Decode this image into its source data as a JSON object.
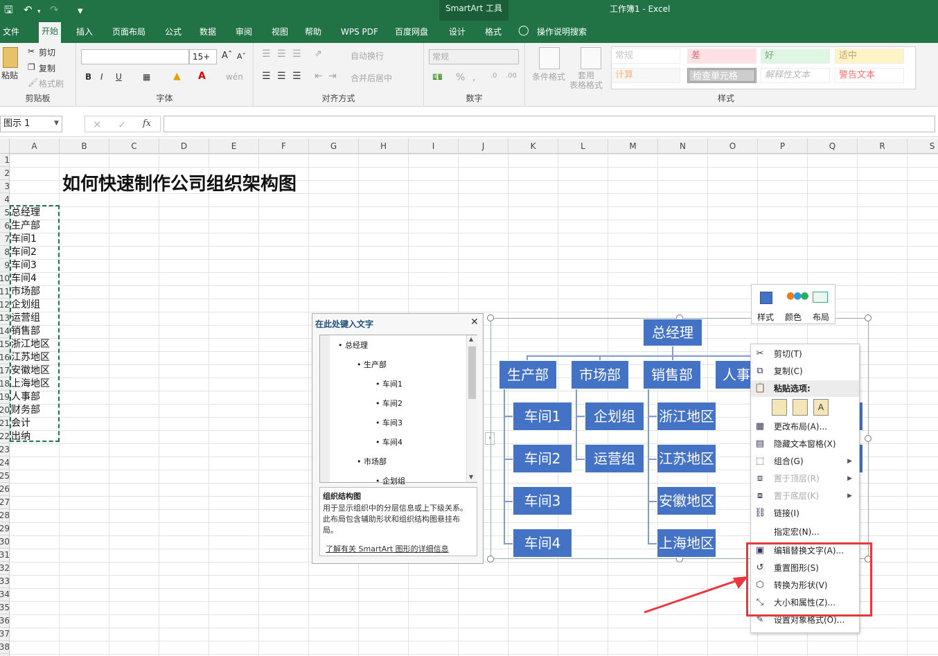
{
  "titlebar": {
    "context_label": "SmartArt 工具",
    "window_title": "工作簿1  -  Excel"
  },
  "tabs": [
    {
      "label": "文件"
    },
    {
      "label": "开始"
    },
    {
      "label": "插入"
    },
    {
      "label": "页面布局"
    },
    {
      "label": "公式"
    },
    {
      "label": "数据"
    },
    {
      "label": "审阅"
    },
    {
      "label": "视图"
    },
    {
      "label": "帮助"
    },
    {
      "label": "WPS PDF"
    },
    {
      "label": "百度网盘"
    },
    {
      "label": "设计"
    },
    {
      "label": "格式"
    }
  ],
  "tellme": "操作说明搜索",
  "ribbon": {
    "clipboard": {
      "paste": "粘贴",
      "cut": "剪切",
      "copy": "复制",
      "format_painter": "格式刷",
      "label": "剪贴板"
    },
    "font": {
      "size": "15+",
      "label": "字体",
      "bold": "B",
      "italic": "I",
      "underline": "U"
    },
    "align": {
      "wrap": "自动换行",
      "merge": "合并后居中",
      "label": "对齐方式"
    },
    "number": {
      "format": "常规",
      "percent": "%",
      "comma": ",",
      "label": "数字"
    },
    "styles": {
      "cond": "条件格式",
      "table": "套用\n表格格式",
      "label": "样式",
      "cells": [
        "常规",
        "差",
        "好",
        "适中",
        "计算",
        "检查单元格",
        "解释性文本",
        "警告文本"
      ]
    }
  },
  "formula_bar": {
    "name_box": "图示 1",
    "fx": "fx"
  },
  "columns": [
    "A",
    "B",
    "C",
    "D",
    "E",
    "F",
    "G",
    "H",
    "I",
    "J",
    "K",
    "L",
    "M",
    "N",
    "O",
    "P",
    "Q",
    "R",
    "S"
  ],
  "rows": [
    "1",
    "2",
    "3",
    "4",
    "5",
    "6",
    "7",
    "8",
    "9",
    "10",
    "11",
    "12",
    "13",
    "14",
    "15",
    "16",
    "17",
    "18",
    "19",
    "20",
    "21",
    "22",
    "23",
    "24",
    "25",
    "26",
    "27",
    "28",
    "29",
    "30",
    "31",
    "32",
    "33",
    "34",
    "35",
    "36",
    "37",
    "38"
  ],
  "sheet": {
    "title": "如何快速制作公司组织架构图",
    "list": [
      "总经理",
      "生产部",
      "车间1",
      "车间2",
      "车间3",
      "车间4",
      "市场部",
      "企划组",
      "运营组",
      "销售部",
      "浙江地区",
      "江苏地区",
      "安徽地区",
      "上海地区",
      "人事部",
      "财务部",
      "会计",
      "出纳"
    ]
  },
  "text_pane": {
    "header": "在此处键入文字",
    "bullets": [
      "总经理",
      "生产部",
      "车间1",
      "车间2",
      "车间3",
      "车间4",
      "市场部",
      "企划组"
    ],
    "desc_title": "组织结构图",
    "desc": "用于显示组织中的分层信息或上下级关系。此布局包含辅助形状和组织结构图悬挂布局。",
    "link": "了解有关 SmartArt 图形的详细信息"
  },
  "smartart": {
    "top": "总经理",
    "level2": [
      "生产部",
      "市场部",
      "销售部",
      "人事"
    ],
    "col1": [
      "车间1",
      "车间2",
      "车间3",
      "车间4"
    ],
    "col2": [
      "企划组",
      "运营组"
    ],
    "col3": [
      "浙江地区",
      "江苏地区",
      "安徽地区",
      "上海地区"
    ]
  },
  "minibar": {
    "style": "样式",
    "color": "颜色",
    "layout": "布局"
  },
  "context_menu": [
    {
      "label": "剪切(T)",
      "icon": "scissors-icon",
      "dim": false
    },
    {
      "label": "复制(C)",
      "icon": "copy-icon",
      "dim": false
    },
    {
      "label": "粘贴选项:",
      "icon": "paste-icon",
      "dim": false,
      "header": true
    },
    {
      "label": "更改布局(A)...",
      "icon": "layout-icon",
      "dim": false
    },
    {
      "label": "隐藏文本窗格(X)",
      "icon": "textpane-icon",
      "dim": false
    },
    {
      "label": "组合(G)",
      "icon": "group-icon",
      "dim": false,
      "sub": true
    },
    {
      "label": "置于顶层(R)",
      "icon": "bring-front-icon",
      "dim": true,
      "sub": true
    },
    {
      "label": "置于底层(K)",
      "icon": "send-back-icon",
      "dim": true,
      "sub": true
    },
    {
      "label": "链接(I)",
      "icon": "link-icon",
      "dim": false
    },
    {
      "label": "指定宏(N)...",
      "icon": "",
      "dim": false
    },
    {
      "label": "编辑替换文字(A)...",
      "icon": "alt-text-icon",
      "dim": false
    },
    {
      "label": "重置图形(S)",
      "icon": "reset-icon",
      "dim": false
    },
    {
      "label": "转换为形状(V)",
      "icon": "convert-icon",
      "dim": false
    },
    {
      "label": "大小和属性(Z)...",
      "icon": "size-icon",
      "dim": false
    },
    {
      "label": "设置对象格式(O)...",
      "icon": "format-icon",
      "dim": false
    }
  ],
  "colors": {
    "excel_green": "#217346",
    "smartart_blue": "#4472c4",
    "highlight_red": "#e8383d"
  }
}
